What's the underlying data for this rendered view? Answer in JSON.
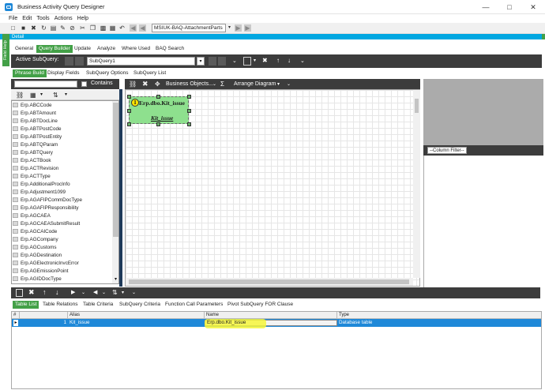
{
  "window": {
    "title": "Business Activity Query Designer"
  },
  "menu": [
    "File",
    "Edit",
    "Tools",
    "Actions",
    "Help"
  ],
  "toolbar": {
    "query_id": "MSIUK-BAQ-AttachmentParts"
  },
  "detail_strip": "Detail",
  "field_help": "Field Help",
  "main_tabs": [
    "General",
    "Query Builder",
    "Update",
    "Analyze",
    "Where Used",
    "BAQ Search"
  ],
  "subquery": {
    "label": "Active SubQuery:",
    "value": "SubQuery1"
  },
  "sub_tabs": [
    "Phrase Build",
    "Display Fields",
    "SubQuery Options",
    "SubQuery List"
  ],
  "table_filter": {
    "contains_label": "Contains",
    "value": ""
  },
  "tables": [
    "Erp.ABCCode",
    "Erp.ABTAmount",
    "Erp.ABTDocLine",
    "Erp.ABTPostCode",
    "Erp.ABTPostEntity",
    "Erp.ABTQParam",
    "Erp.ABTQuery",
    "Erp.ACTBook",
    "Erp.ACTRevision",
    "Erp.ACTType",
    "Erp.AdditionalProcInfo",
    "Erp.Adjustment1099",
    "Erp.AGAFIPCommDocType",
    "Erp.AGAFIPResponsibility",
    "Erp.AGCAEA",
    "Erp.AGCAEASubmitResult",
    "Erp.AGCAICode",
    "Erp.AGCompany",
    "Erp.AGCustoms",
    "Erp.AGDestination",
    "Erp.AGElectronicInvcError",
    "Erp.AGEmissionPoint",
    "Erp.AGIDDocType"
  ],
  "diagram": {
    "business_objects_label": "Business Objects...",
    "arrange_label": "Arrange Diagram",
    "sigma": "Σ",
    "node": {
      "badge": "1",
      "title": "Erp.dbo.Kit_issue",
      "alias": "Kit_issue"
    }
  },
  "column_filter": "--Column Filter--",
  "bottom_tabs": [
    "Table List",
    "Table Relations",
    "Table Criteria",
    "SubQuery Criteria",
    "Function Call Parameters",
    "Pivot SubQuery FOR Clause"
  ],
  "grid": {
    "headers": [
      "#",
      "Alias",
      "Name",
      "Type"
    ],
    "rows": [
      {
        "num": "1",
        "alias": "Kit_issue",
        "name": "Erp.dbo.Kit_issue",
        "type": "Database table"
      }
    ]
  },
  "colors": {
    "accent_green": "#43a047",
    "strip_blue": "#00a7e1",
    "selection_blue": "#1e88d8",
    "node_green": "#8ee08e",
    "highlight_yellow": "#f6f63a"
  }
}
